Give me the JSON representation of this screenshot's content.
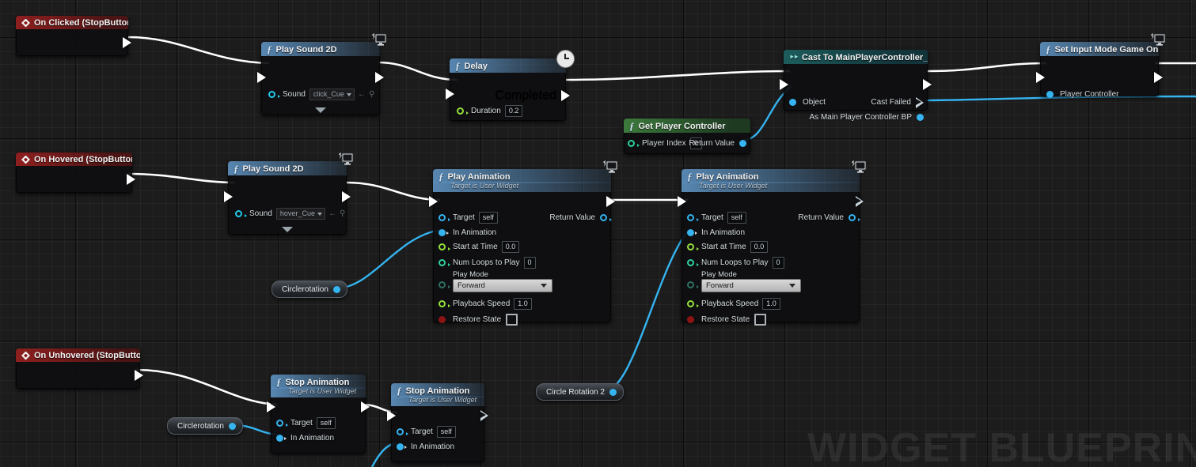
{
  "watermark": "WIDGET BLUEPRINT",
  "events": [
    {
      "title": "On Clicked (StopButton)",
      "icon": "event-diamond-icon"
    },
    {
      "title": "On Hovered (StopButton)",
      "icon": "event-diamond-icon"
    },
    {
      "title": "On Unhovered (StopButton)",
      "icon": "event-diamond-icon"
    }
  ],
  "play_sound_click": {
    "title": "Play Sound 2D",
    "icon": "function-f-icon",
    "corner_icon": "monitor-icon",
    "sound_label": "Sound",
    "sound_value": "click_Cue"
  },
  "play_sound_hover": {
    "title": "Play Sound 2D",
    "icon": "function-f-icon",
    "corner_icon": "monitor-icon",
    "sound_label": "Sound",
    "sound_value": "hover_Cue"
  },
  "delay": {
    "title": "Delay",
    "icon": "function-f-icon",
    "corner_icon": "clock-icon",
    "completed_label": "Completed",
    "duration_label": "Duration",
    "duration_value": "0.2"
  },
  "get_player_controller": {
    "title": "Get Player Controller",
    "icon": "function-f-icon",
    "player_index_label": "Player Index",
    "player_index_value": "0",
    "return_label": "Return Value"
  },
  "cast_node": {
    "title": "Cast To MainPlayerController_BP",
    "icon": "cast-arrows-icon",
    "object_label": "Object",
    "cast_failed_label": "Cast Failed",
    "as_label": "As Main Player Controller BP"
  },
  "set_input_mode": {
    "title": "Set Input Mode Game Only",
    "icon": "function-f-icon",
    "corner_icon": "monitor-icon",
    "player_controller_label": "Player Controller"
  },
  "play_animation_1": {
    "title": "Play Animation",
    "subtitle": "Target is User Widget",
    "icon": "function-f-icon",
    "corner_icon": "monitor-icon",
    "target_label": "Target",
    "target_value": "self",
    "in_animation_label": "In Animation",
    "start_at_time_label": "Start at Time",
    "start_at_time_value": "0.0",
    "num_loops_label": "Num Loops to Play",
    "num_loops_value": "0",
    "play_mode_label": "Play Mode",
    "play_mode_value": "Forward",
    "playback_speed_label": "Playback Speed",
    "playback_speed_value": "1.0",
    "restore_state_label": "Restore State",
    "return_label": "Return Value"
  },
  "play_animation_2": {
    "title": "Play Animation",
    "subtitle": "Target is User Widget",
    "icon": "function-f-icon",
    "corner_icon": "monitor-icon",
    "target_label": "Target",
    "target_value": "self",
    "in_animation_label": "In Animation",
    "start_at_time_label": "Start at Time",
    "start_at_time_value": "0.0",
    "num_loops_label": "Num Loops to Play",
    "num_loops_value": "0",
    "play_mode_label": "Play Mode",
    "play_mode_value": "Forward",
    "playback_speed_label": "Playback Speed",
    "playback_speed_value": "1.0",
    "restore_state_label": "Restore State",
    "return_label": "Return Value"
  },
  "stop_animation_1": {
    "title": "Stop Animation",
    "subtitle": "Target is User Widget",
    "icon": "function-f-icon",
    "target_label": "Target",
    "target_value": "self",
    "in_animation_label": "In Animation"
  },
  "stop_animation_2": {
    "title": "Stop Animation",
    "subtitle": "Target is User Widget",
    "icon": "function-f-icon",
    "target_label": "Target",
    "target_value": "self",
    "in_animation_label": "In Animation"
  },
  "variables": [
    {
      "name": "Circlerotation"
    },
    {
      "name": "Circle Rotation 2"
    },
    {
      "name": "Circlerotation"
    }
  ],
  "colors": {
    "exec_wire": "#ffffff",
    "object_wire": "#35b4f0",
    "event_header": "#8e1f1f",
    "function_header": "#3f6d96",
    "cast_header": "#1d5c5c",
    "pure_header": "#3c7a3c",
    "float_pin": "#96e03c",
    "int_pin": "#2fd0a0",
    "bool_pin": "#a01414",
    "object_pin": "#35b4f0",
    "canvas_bg": "#1c1c1c"
  }
}
